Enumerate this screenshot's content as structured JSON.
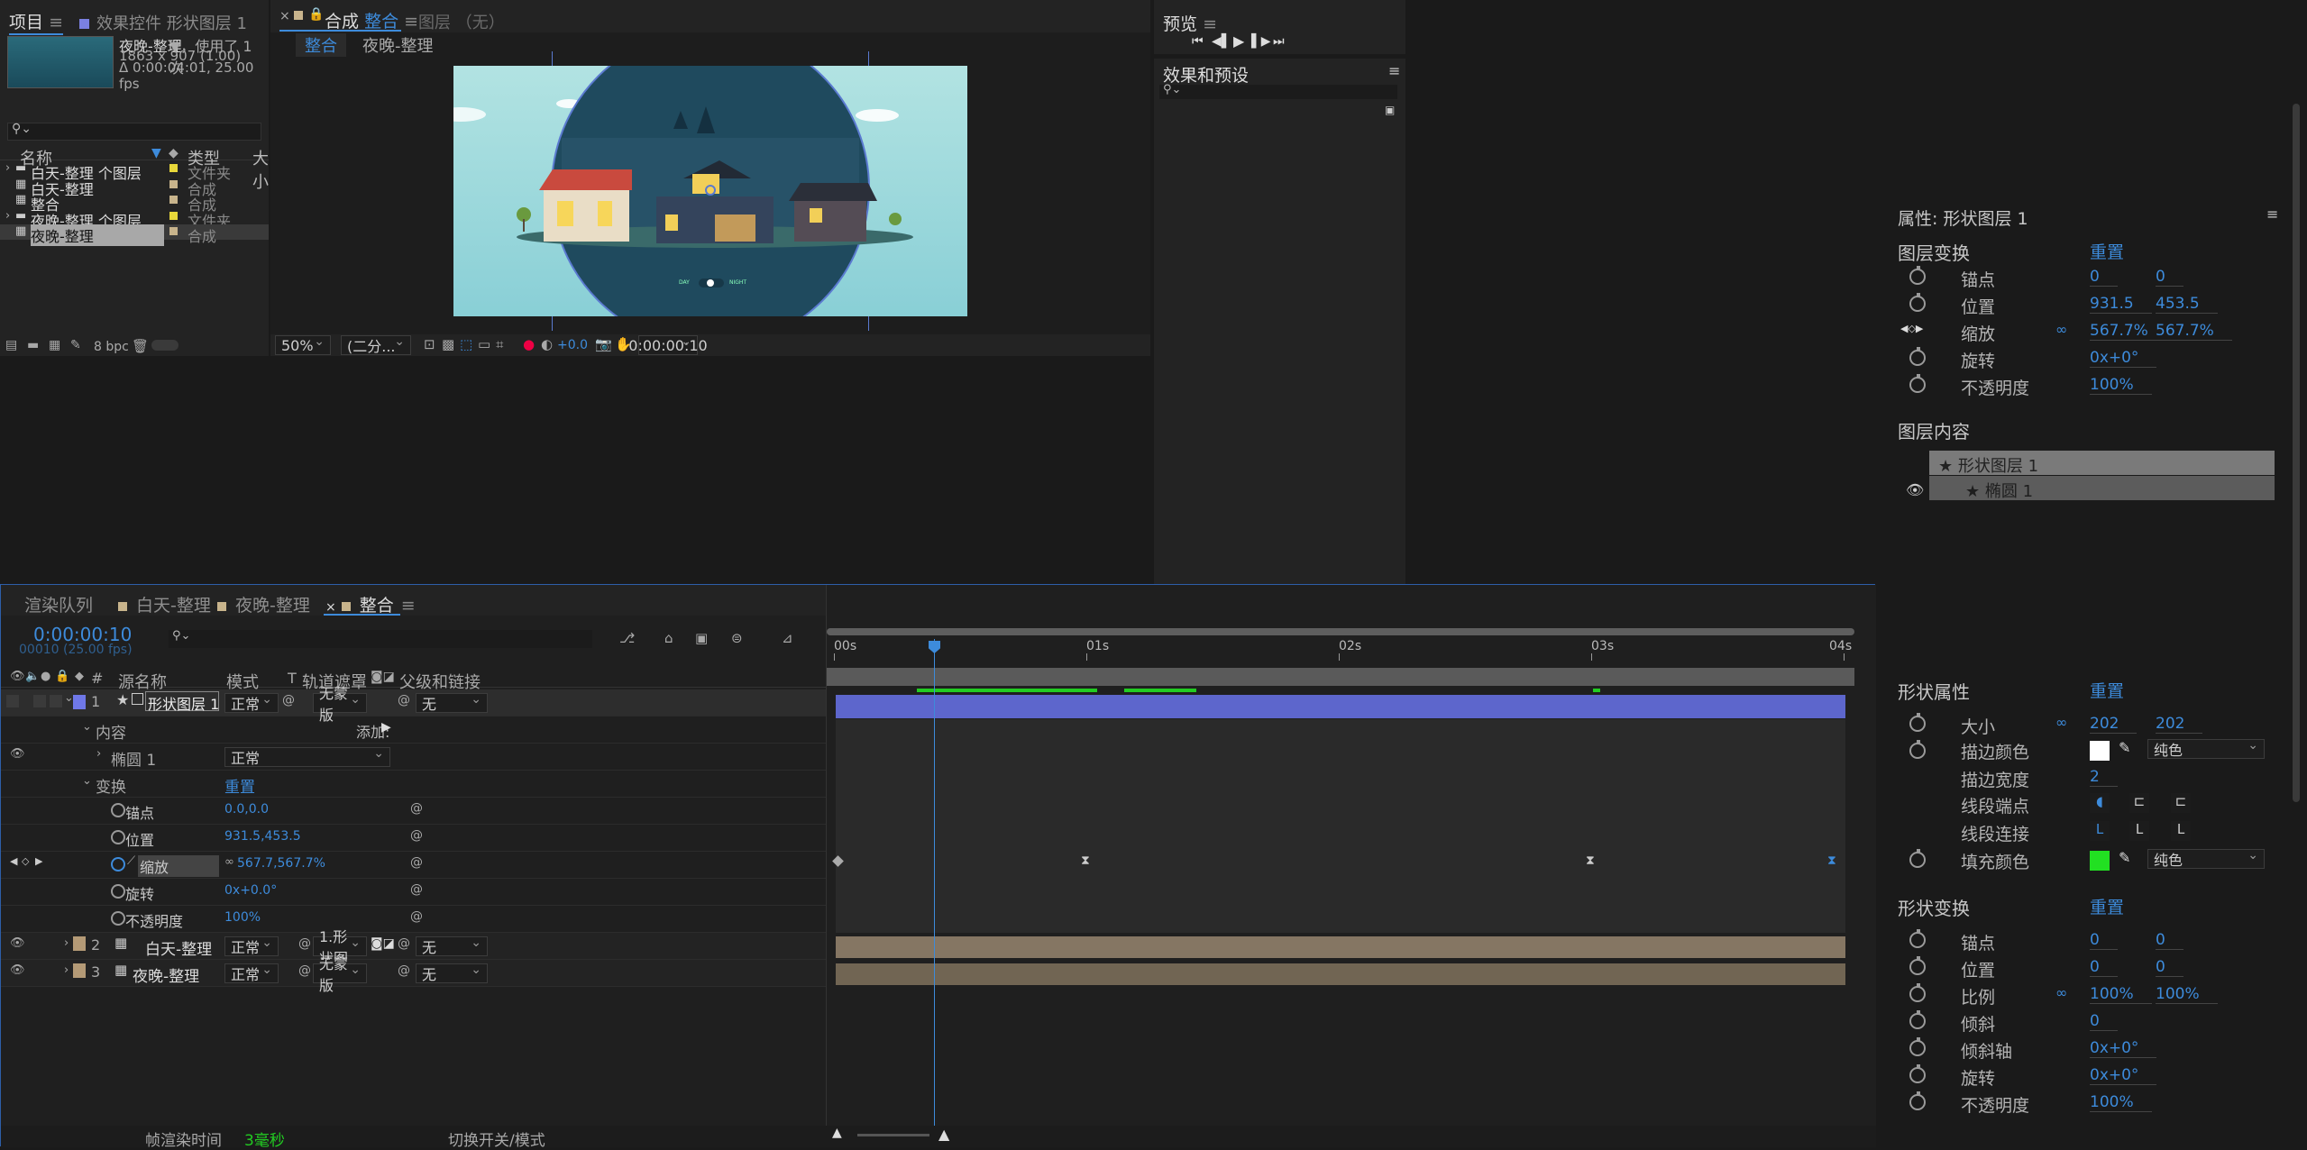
{
  "project": {
    "tab_project": "项目",
    "tab_effects": "效果控件 形状图层 1",
    "item_name": "夜晚-整理",
    "item_used": "▼，使用了 1 次",
    "item_dims": "1863 x 907 (1.00)",
    "item_duration": "Δ 0:00:04:01, 25.00 fps",
    "col_name": "名称",
    "col_type": "类型",
    "col_size": "大小",
    "items": [
      {
        "name": "白天-整理 个图层",
        "type": "文件夹",
        "kind": "folder"
      },
      {
        "name": "白天-整理",
        "type": "合成",
        "kind": "comp"
      },
      {
        "name": "整合",
        "type": "合成",
        "kind": "comp"
      },
      {
        "name": "夜晚-整理 个图层",
        "type": "文件夹",
        "kind": "folder"
      },
      {
        "name": "夜晚-整理",
        "type": "合成",
        "kind": "comp"
      }
    ],
    "bpc": "8 bpc"
  },
  "viewer": {
    "tab_comp_prefix": "合成",
    "tab_comp_name": "整合",
    "tab_layer": "图层 （无）",
    "crumb_1": "整合",
    "crumb_2": "夜晚-整理",
    "zoom": "50%",
    "resolution": "(二分...",
    "exposure": "+0.0",
    "timecode": "0:00:00:10",
    "day_label": "DAY",
    "night_label": "NIGHT"
  },
  "timeline": {
    "tabs": [
      "渲染队列",
      "白天-整理",
      "夜晚-整理",
      "整合"
    ],
    "timecode": "0:00:00:10",
    "frame_info": "00010 (25.00 fps)",
    "col_num": "#",
    "col_source": "源名称",
    "col_mode": "模式",
    "col_t": "T",
    "col_trkmat": "轨道遮罩",
    "col_parent": "父级和链接",
    "ruler": [
      "00s",
      "01s",
      "02s",
      "03s",
      "04s"
    ],
    "layer1": {
      "num": "1",
      "name": "形状图层 1",
      "mode": "正常",
      "mat": "无蒙版",
      "parent": "无"
    },
    "contents": "内容",
    "add_label": "添加:",
    "ellipse": "椭圆 1",
    "ellipse_mode": "正常",
    "transform": "变换",
    "reset": "重置",
    "props": [
      {
        "name": "锚点",
        "value": "0.0,0.0"
      },
      {
        "name": "位置",
        "value": "931.5,453.5"
      },
      {
        "name": "缩放",
        "value": "567.7,567.7%"
      },
      {
        "name": "旋转",
        "value": "0x+0.0°"
      },
      {
        "name": "不透明度",
        "value": "100%"
      }
    ],
    "layer2": {
      "num": "2",
      "name": "白天-整理",
      "mode": "正常",
      "mat": "1.形状图",
      "parent": "无"
    },
    "layer3": {
      "num": "3",
      "name": "夜晚-整理",
      "mode": "正常",
      "mat": "无蒙版",
      "parent": "无"
    },
    "render_time_label": "帧渲染时间",
    "render_time": "3毫秒",
    "switch_modes": "切换开关/模式"
  },
  "preview": {
    "title": "预览"
  },
  "effects": {
    "title": "效果和预设",
    "props_title": "属性: 形状图层 1",
    "layer_transform": "图层变换",
    "reset": "重置",
    "lt": [
      {
        "name": "锚点",
        "v1": "0",
        "v2": "0"
      },
      {
        "name": "位置",
        "v1": "931.5",
        "v2": "453.5"
      },
      {
        "name": "缩放",
        "v1": "567.7%",
        "v2": "567.7%"
      },
      {
        "name": "旋转",
        "v1": "0x+0°",
        "v2": ""
      },
      {
        "name": "不透明度",
        "v1": "100%",
        "v2": ""
      }
    ],
    "layer_contents": "图层内容",
    "content_1": "形状图层 1",
    "content_2": "椭圆 1",
    "shape_props": "形状属性",
    "sp": {
      "size_label": "大小",
      "size_1": "202",
      "size_2": "202",
      "stroke_color": "描边颜色",
      "stroke_type": "纯色",
      "stroke_width": "描边宽度",
      "stroke_width_v": "2",
      "line_cap": "线段端点",
      "line_join": "线段连接",
      "fill_color": "填充颜色",
      "fill_type": "纯色"
    },
    "shape_transform": "形状变换",
    "st": [
      {
        "name": "锚点",
        "v1": "0",
        "v2": "0"
      },
      {
        "name": "位置",
        "v1": "0",
        "v2": "0"
      },
      {
        "name": "比例",
        "v1": "100%",
        "v2": "100%"
      },
      {
        "name": "倾斜",
        "v1": "0",
        "v2": ""
      },
      {
        "name": "倾斜轴",
        "v1": "0x+0°",
        "v2": ""
      },
      {
        "name": "旋转",
        "v1": "0x+0°",
        "v2": ""
      },
      {
        "name": "不透明度",
        "v1": "100%",
        "v2": ""
      }
    ],
    "colors": {
      "accent": "#3d8bdb",
      "layer1": "#6f78e8",
      "fill": "#22e022"
    }
  }
}
